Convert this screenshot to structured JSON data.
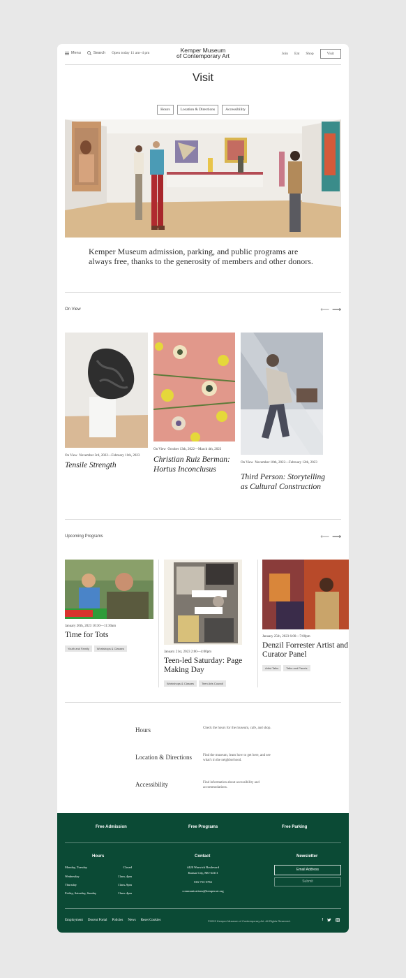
{
  "header": {
    "menu_label": "Menu",
    "search_label": "Search",
    "hours_text": "Open today 11 am–4 pm",
    "logo_line1": "Kemper Museum",
    "logo_line2": "of Contemporary Art",
    "nav": [
      "Join",
      "Eat",
      "Shop"
    ],
    "visit_label": "Visit"
  },
  "page_title": "Visit",
  "tabs": [
    "Hours",
    "Location & Directions",
    "Accessibility"
  ],
  "intro": "Kemper Museum admission, parking, and public programs are always free, thanks to the generosity of members and other donors.",
  "on_view": {
    "title": "On View",
    "items": [
      {
        "label": "On View",
        "dates": "November 3rd, 2022—February 11th, 2023",
        "title": "Tensile Strength"
      },
      {
        "label": "On View",
        "dates": "October 13th, 2022—March 4th, 2023",
        "title": "Christian Ruiz Berman: Hortus Inconclusus"
      },
      {
        "label": "On View",
        "dates": "November 10th, 2022—February 12th, 2023",
        "title": "Third Person: Storytelling as Cultural Construction"
      }
    ]
  },
  "programs": {
    "title": "Upcoming Programs",
    "items": [
      {
        "date": "January 20th, 2023 10:30—11:30am",
        "title": "Time for Tots",
        "tags": [
          "Youth and Family",
          "Workshops & Classes"
        ]
      },
      {
        "date": "January 21st, 2023 2:00—4:00pm",
        "title": "Teen-led Saturday: Page Making Day",
        "tags": [
          "Workshops & Classes",
          "Teen Arts Council"
        ]
      },
      {
        "date": "January 25th, 2023 6:00—7:00pm",
        "title": "Denzil Forrester Artist and Curator Panel",
        "tags": [
          "Artist Talks",
          "Talks and Panels"
        ]
      }
    ]
  },
  "info": [
    {
      "label": "Hours",
      "desc": "Check the hours for the museum, cafe, and shop."
    },
    {
      "label": "Location & Directions",
      "desc": "Find the museum, learn how to get here, and see what's in the neighborhood."
    },
    {
      "label": "Accessibility",
      "desc": "Find information about accessibility and accommodations."
    }
  ],
  "footer": {
    "top": [
      "Free Admission",
      "Free Programs",
      "Free Parking"
    ],
    "hours_title": "Hours",
    "hours": [
      {
        "days": "Monday, Tuesday",
        "time": "Closed"
      },
      {
        "days": "Wednesday",
        "time": "11am–4pm"
      },
      {
        "days": "Thursday",
        "time": "11am–9pm"
      },
      {
        "days": "Friday, Saturday, Sunday",
        "time": "11am–4pm"
      }
    ],
    "contact_title": "Contact",
    "address1": "4420 Warwick Boulevard",
    "address2": "Kansas City, MO 64111",
    "phone": "816-753-5784",
    "email": "communications@kemperart.org",
    "newsletter_title": "Newsletter",
    "email_placeholder": "Email Address",
    "submit_label": "Submit",
    "links": [
      "Employment",
      "Docent Portal",
      "Policies",
      "News",
      "Reset Cookies"
    ],
    "copyright": "©2022 Kemper Museum of Contemporary Art. All Rights Reserved."
  },
  "colors": {
    "footer_bg": "#0b4a35",
    "page_bg": "#e8e8e8"
  }
}
